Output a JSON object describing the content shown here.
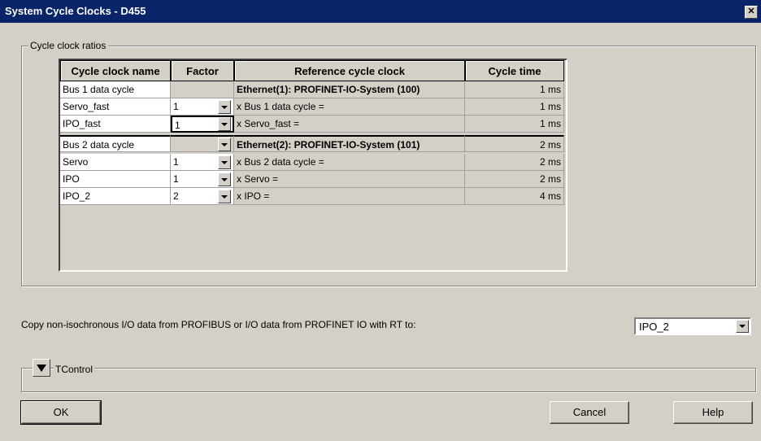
{
  "window": {
    "title": "System Cycle Clocks - D455",
    "close_glyph": "✕",
    "icons": {
      "close": "close-icon",
      "dropdown": "chevron-down-icon",
      "expand": "triangle-down-icon"
    }
  },
  "group": {
    "label": "Cycle clock ratios"
  },
  "table": {
    "headers": [
      "Cycle clock name",
      "Factor",
      "Reference cycle clock",
      "Cycle time"
    ],
    "rows": [
      {
        "name": "Bus 1 data cycle",
        "factor": "",
        "reference": "Ethernet(1): PROFINET-IO-System (100)",
        "time": "1 ms"
      },
      {
        "name": "Servo_fast",
        "factor": "1",
        "reference": "x Bus 1 data cycle =",
        "time": "1 ms"
      },
      {
        "name": "IPO_fast",
        "factor": "1",
        "reference": "x Servo_fast =",
        "time": "1 ms"
      },
      {
        "name": "Bus 2 data cycle",
        "factor": "",
        "reference": "Ethernet(2): PROFINET-IO-System (101)",
        "time": "2 ms"
      },
      {
        "name": "Servo",
        "factor": "1",
        "reference": "x Bus 2 data cycle =",
        "time": "2 ms"
      },
      {
        "name": "IPO",
        "factor": "1",
        "reference": "x Servo =",
        "time": "2 ms"
      },
      {
        "name": "IPO_2",
        "factor": "2",
        "reference": "x IPO =",
        "time": "4 ms"
      }
    ]
  },
  "copy": {
    "label": "Copy non-isochronous I/O data from PROFIBUS or I/O data from PROFINET IO with RT to:",
    "value": "IPO_2"
  },
  "tcontrol": {
    "label": "TControl"
  },
  "buttons": {
    "ok": "OK",
    "cancel": "Cancel",
    "help": "Help"
  }
}
